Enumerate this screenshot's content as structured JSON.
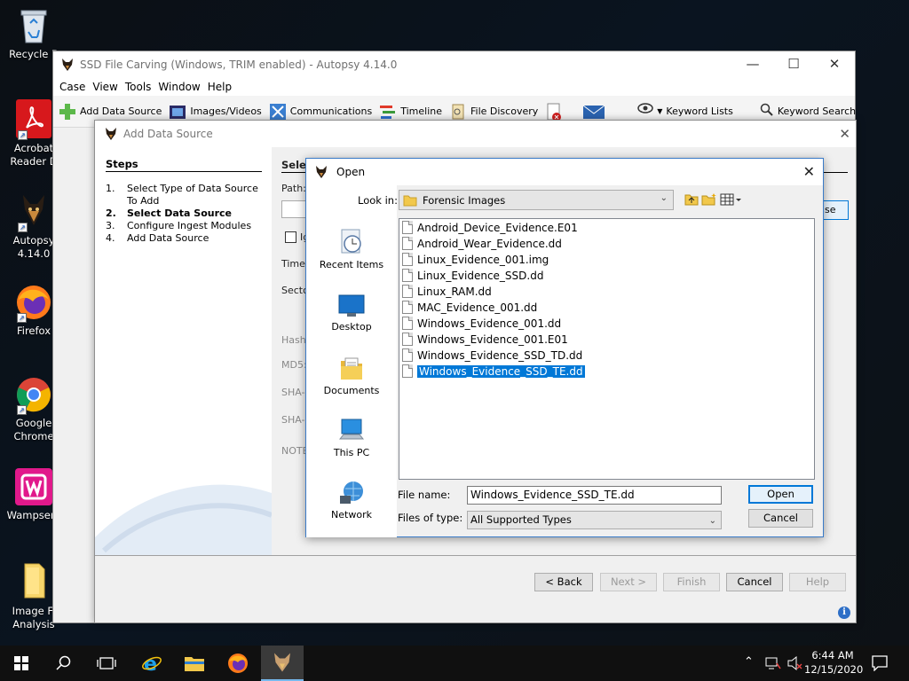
{
  "desktop": {
    "icons": [
      {
        "label": "Recycle Bin",
        "display": "Recycle B"
      },
      {
        "label": "Acrobat Reader DC",
        "display": "Acrobat\nReader D"
      },
      {
        "label": "Autopsy 4.14.0",
        "display": "Autopsy\n4.14.0"
      },
      {
        "label": "Firefox",
        "display": "Firefox"
      },
      {
        "label": "Google Chrome",
        "display": "Google\nChrome"
      },
      {
        "label": "Wampserver",
        "display": "Wampserv"
      },
      {
        "label": "Image File Analysis",
        "display": "Image Fi\nAnalysis"
      }
    ]
  },
  "main_window": {
    "title": "SSD File Carving (Windows, TRIM enabled) - Autopsy 4.14.0",
    "menu": [
      "Case",
      "View",
      "Tools",
      "Window",
      "Help"
    ],
    "toolbar": {
      "add_data_source": "Add Data Source",
      "images_videos": "Images/Videos",
      "communications": "Communications",
      "timeline": "Timeline",
      "file_discovery": "File Discovery",
      "keyword_lists": "Keyword Lists",
      "keyword_search": "Keyword Search"
    }
  },
  "add_data_source": {
    "title": "Add Data Source",
    "steps_heading": "Steps",
    "steps": [
      {
        "num": "1.",
        "label": "Select Type of Data Source To Add",
        "current": false
      },
      {
        "num": "2.",
        "label": "Select Data Source",
        "current": true
      },
      {
        "num": "3.",
        "label": "Configure Ingest Modules",
        "current": false
      },
      {
        "num": "4.",
        "label": "Add Data Source",
        "current": false
      }
    ],
    "panel": {
      "heading_partial": "Selec",
      "path_label": "Path:",
      "browse_partial": "se",
      "ignore_partial": "Ig",
      "time_partial": "Time z",
      "sector_partial": "Secto",
      "hash_partial": "Hash",
      "md5_label": "MD5:",
      "sha1_partial": "SHA-1",
      "sha256_partial": "SHA-2",
      "note_partial": "NOTE"
    },
    "buttons": {
      "back": "< Back",
      "next": "Next >",
      "finish": "Finish",
      "cancel": "Cancel",
      "help": "Help"
    }
  },
  "open_dialog": {
    "title": "Open",
    "look_in_label": "Look in:",
    "look_in_value": "Forensic Images",
    "places": [
      "Recent Items",
      "Desktop",
      "Documents",
      "This PC",
      "Network"
    ],
    "files": [
      {
        "name": "Android_Device_Evidence.E01",
        "selected": false
      },
      {
        "name": "Android_Wear_Evidence.dd",
        "selected": false
      },
      {
        "name": "Linux_Evidence_001.img",
        "selected": false
      },
      {
        "name": "Linux_Evidence_SSD.dd",
        "selected": false
      },
      {
        "name": "Linux_RAM.dd",
        "selected": false
      },
      {
        "name": "MAC_Evidence_001.dd",
        "selected": false
      },
      {
        "name": "Windows_Evidence_001.dd",
        "selected": false
      },
      {
        "name": "Windows_Evidence_001.E01",
        "selected": false
      },
      {
        "name": "Windows_Evidence_SSD_TD.dd",
        "selected": false
      },
      {
        "name": "Windows_Evidence_SSD_TE.dd",
        "selected": true
      }
    ],
    "file_name_label": "File name:",
    "file_name_value": "Windows_Evidence_SSD_TE.dd",
    "files_of_type_label": "Files of type:",
    "files_of_type_value": "All Supported Types",
    "open_button": "Open",
    "cancel_button": "Cancel"
  },
  "taskbar": {
    "time": "6:44 AM",
    "date": "12/15/2020"
  },
  "colors": {
    "selection": "#0078d7",
    "dialog_border": "#3a7bc8",
    "taskbar": "#101010"
  }
}
